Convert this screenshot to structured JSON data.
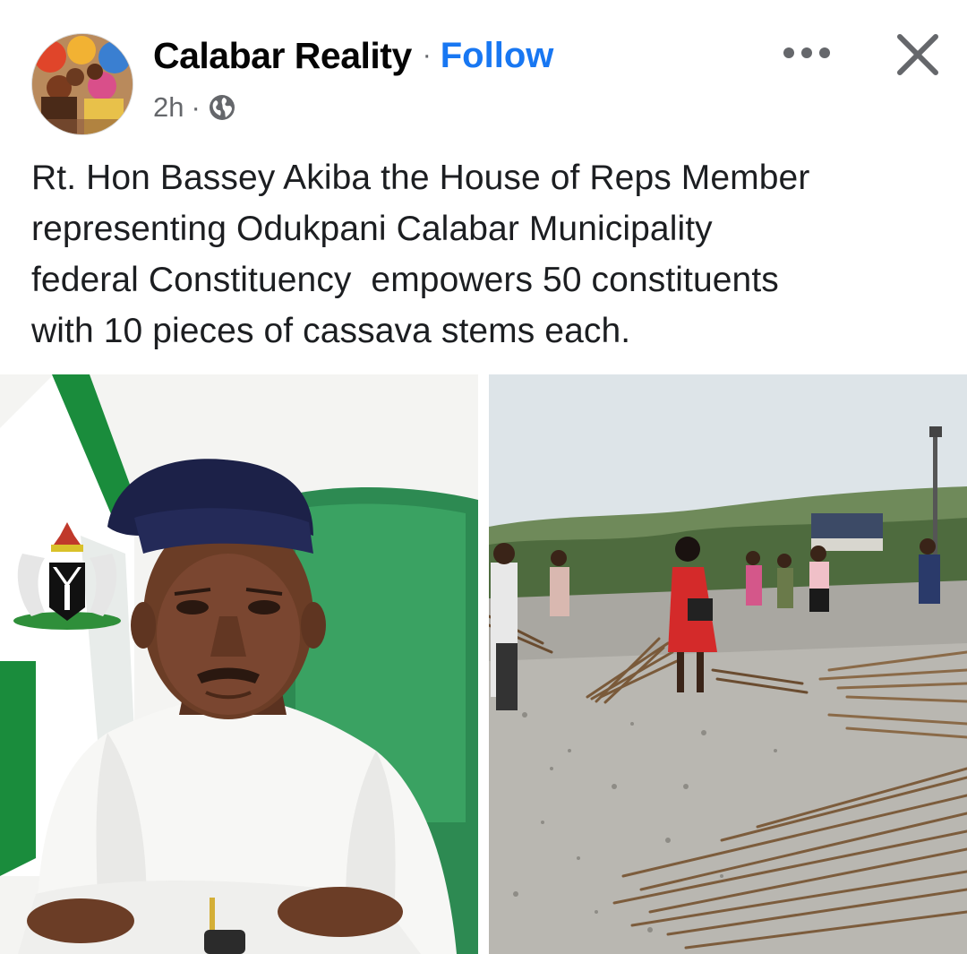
{
  "post": {
    "page_name": "Calabar Reality",
    "separator": "·",
    "follow_label": "Follow",
    "timestamp": "2h",
    "audience_icon": "globe-icon",
    "more_icon": "more-options-icon",
    "close_icon": "close-icon",
    "text_lines": [
      "Rt. Hon Bassey Akiba the House of Reps Member",
      "representing Odukpani Calabar Municipality",
      "federal Constituency  empowers 50 constituents",
      "with 10 pieces of cassava stems each."
    ]
  },
  "colors": {
    "link_blue": "#1877f2",
    "text_primary": "#050505",
    "text_secondary": "#65676b"
  }
}
